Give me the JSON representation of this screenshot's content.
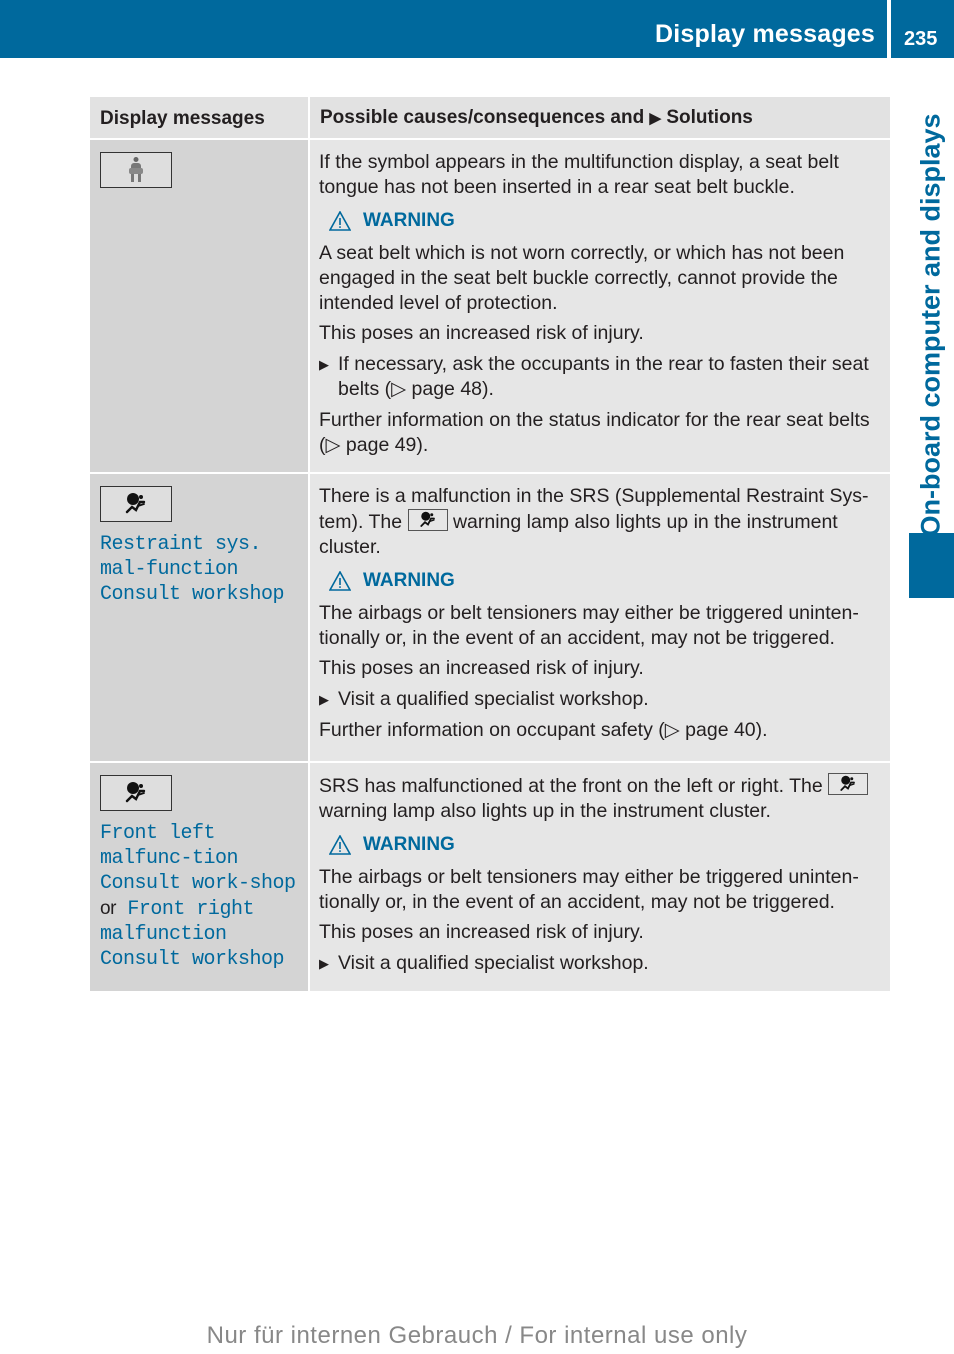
{
  "header": {
    "section_title": "Display messages",
    "page_number": "235",
    "chapter_tab": "On-board computer and displays"
  },
  "table": {
    "columns": [
      "Display messages",
      "Possible causes/consequences and",
      "Solutions"
    ],
    "rows": [
      {
        "icon": "rear-seat-belt-occupant-icon",
        "message": "",
        "intro": "If the symbol appears in the multifunction display, a seat belt tongue has not been inserted in a rear seat belt buckle.",
        "warning_label": "WARNING",
        "warning_text": "A seat belt which is not worn correctly, or which has not been engaged in the seat belt buckle correctly, cannot provide the intended level of protection.",
        "risk": "This poses an increased risk of injury.",
        "step": "If necessary, ask the occupants in the rear to fasten their seat belts (▷ page 48).",
        "further": "Further information on the status indicator for the rear seat belts (▷ page 49)."
      },
      {
        "icon": "srs-airbag-warning-icon",
        "message": "Restraint sys. mal‑function Consult workshop",
        "intro_before": "There is a malfunction in the SRS (Supplemental Restraint Sys­tem). The",
        "intro_after": "warning lamp also lights up in the instrument clus­ter.",
        "warning_label": "WARNING",
        "warning_text": "The airbags or belt tensioners may either be triggered uninten­tionally or, in the event of an accident, may not be triggered.",
        "risk": "This poses an increased risk of injury.",
        "step": "Visit a qualified specialist workshop.",
        "further": "Further information on occupant safety (▷ page 40)."
      },
      {
        "icon": "srs-airbag-warning-icon",
        "message_a": "Front left malfunc‑tion Consult work‑shop",
        "message_or": "or",
        "message_b": "Front right malfunction Consult workshop",
        "intro_before": "SRS has malfunctioned at the front on the left or right. The",
        "intro_after": "warning lamp also lights up in the instrument cluster.",
        "warning_label": "WARNING",
        "warning_text": "The airbags or belt tensioners may either be triggered uninten­tionally or, in the event of an accident, may not be triggered.",
        "risk": "This poses an increased risk of injury.",
        "step": "Visit a qualified specialist workshop."
      }
    ]
  },
  "footer": {
    "watermark": "Nur für internen Gebrauch / For internal use only"
  },
  "colors": {
    "brand_blue": "#00699d",
    "cell_dark": "#d4d4d4",
    "cell_light": "#e6e6e6"
  }
}
